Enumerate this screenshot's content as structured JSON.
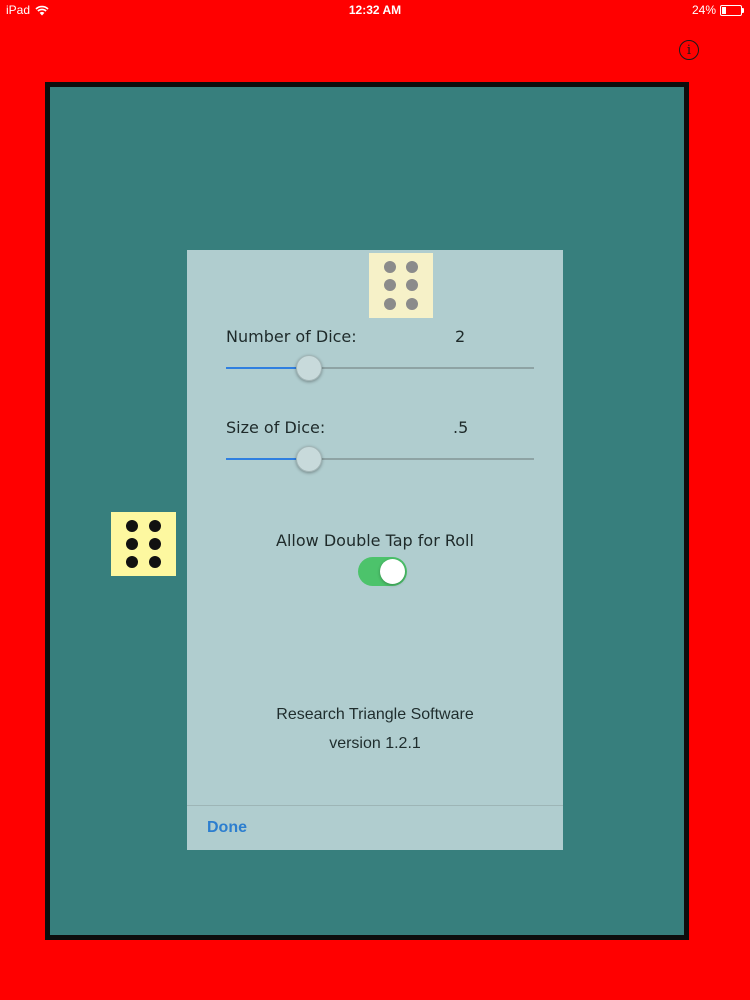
{
  "status_bar": {
    "device": "iPad",
    "time": "12:32 AM",
    "battery": "24%",
    "battery_level": 0.24
  },
  "info_button": {
    "glyph": "i"
  },
  "settings": {
    "number_of_dice_label": "Number of Dice:",
    "number_of_dice_value": "2",
    "number_of_dice_slider_fraction": 0.27,
    "size_of_dice_label": "Size of Dice:",
    "size_of_dice_value": ".5",
    "size_of_dice_slider_fraction": 0.27,
    "double_tap_label": "Allow Double Tap for Roll",
    "double_tap_enabled": true,
    "company": "Research Triangle Software",
    "version": "version 1.2.1",
    "done_label": "Done"
  },
  "dice": [
    {
      "pips": 6,
      "state": "settled"
    },
    {
      "pips": 6,
      "state": "preview"
    }
  ],
  "colors": {
    "background": "#ff0000",
    "board": "#377f7d",
    "die_face": "#fdf8a0",
    "popover": "#b0cdcf",
    "accent": "#2f7fe0",
    "toggle_on": "#4cc36b"
  }
}
